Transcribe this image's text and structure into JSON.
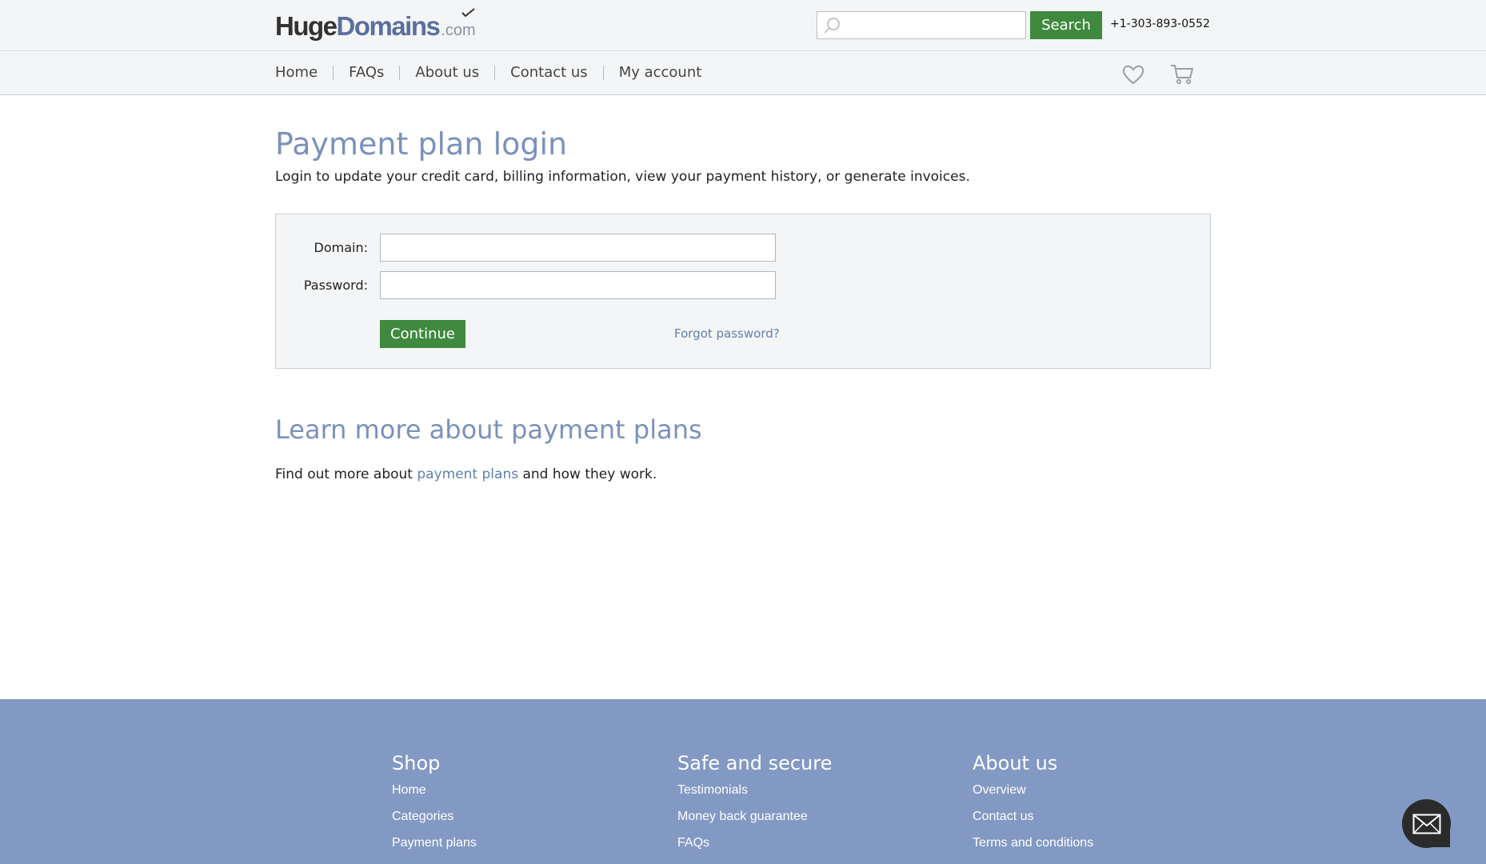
{
  "header": {
    "logo": {
      "part1": "Huge",
      "part2": "Domains",
      "suffix": ".com"
    },
    "search": {
      "placeholder": "",
      "button_label": "Search"
    },
    "phone": "+1-303-893-0552"
  },
  "nav": {
    "items": [
      {
        "label": "Home"
      },
      {
        "label": "FAQs"
      },
      {
        "label": "About us"
      },
      {
        "label": "Contact us"
      },
      {
        "label": "My account"
      }
    ],
    "icons": [
      "heart-icon",
      "cart-icon"
    ]
  },
  "main": {
    "title": "Payment plan login",
    "intro": "Login to update your credit card, billing information, view your payment history, or generate invoices.",
    "form": {
      "domain_label": "Domain:",
      "domain_value": "",
      "password_label": "Password:",
      "password_value": "",
      "continue_label": "Continue",
      "forgot_label": "Forgot password?"
    },
    "learn": {
      "heading": "Learn more about payment plans",
      "text_before": "Find out more about ",
      "link": "payment plans",
      "text_after": " and how they work."
    }
  },
  "footer": {
    "columns": [
      {
        "title": "Shop",
        "links": [
          "Home",
          "Categories",
          "Payment plans"
        ]
      },
      {
        "title": "Safe and secure",
        "links": [
          "Testimonials",
          "Money back guarantee",
          "FAQs"
        ]
      },
      {
        "title": "About us",
        "links": [
          "Overview",
          "Contact us",
          "Terms and conditions"
        ]
      }
    ]
  },
  "colors": {
    "accent_green": "#3f8a3e",
    "heading_blue": "#7a91bc",
    "link_blue": "#5f7fae",
    "footer_bg": "#8299c3",
    "bar_bg": "#f4f5f6"
  }
}
